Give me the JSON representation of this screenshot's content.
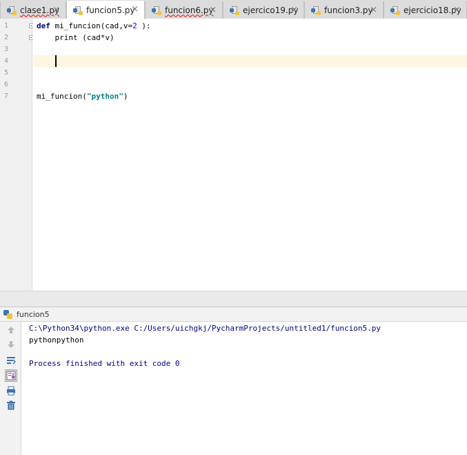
{
  "tabs": [
    {
      "label": "clase1.py",
      "active": false,
      "error": true
    },
    {
      "label": "funcion5.py",
      "active": true,
      "error": false
    },
    {
      "label": "funcion6.py",
      "active": false,
      "error": true
    },
    {
      "label": "ejercico19.py",
      "active": false,
      "error": false
    },
    {
      "label": "funcion3.py",
      "active": false,
      "error": false
    },
    {
      "label": "ejercicio18.py",
      "active": false,
      "error": false
    }
  ],
  "close_glyph": "×",
  "editor": {
    "line_numbers": [
      "1",
      "2",
      "3",
      "4",
      "5",
      "6",
      "7"
    ],
    "line1": {
      "kw": "def",
      "name": " mi_funcion(cad,v=",
      "num": "2",
      "rest": " ):"
    },
    "line2": {
      "indent": "    ",
      "text": "print (cad*v)"
    },
    "line7": {
      "call": "mi_funcion(",
      "str": "\"python\"",
      "close": ")"
    }
  },
  "run_panel": {
    "title": "funcion5",
    "lines": [
      "C:\\Python34\\python.exe C:/Users/uichgkj/PycharmProjects/untitled1/funcion5.py",
      "pythonpython",
      "",
      "Process finished with exit code 0"
    ]
  },
  "toolbar_icons": [
    "up-arrow-icon",
    "down-arrow-icon",
    "soft-wrap-icon",
    "scroll-to-end-icon",
    "print-icon",
    "trash-icon"
  ]
}
